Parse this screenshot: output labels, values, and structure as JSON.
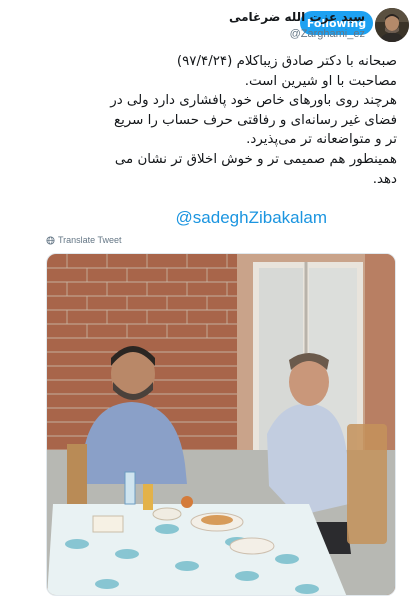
{
  "header": {
    "display_name": "سید عزت الله ضرغامی",
    "handle": "@Zarghami_ez",
    "follow_label": "Following",
    "avatar_icon": "avatar-photo",
    "menu_icon": "chevron-down-icon"
  },
  "tweet": {
    "lines": [
      "صبحانه با دکتر صادق زیباکلام (۹۷/۴/۲۴)",
      "مصاحبت با او شیرین است.",
      "هرچند روی باورهای خاص خود پافشاری دارد ولی در",
      "فضای غیر رسانه‌ای و رفاقتی حرف حساب را سریع",
      "تر  و متواضعانه تر می‌پذیرد.",
      "همینطور هم صمیمی تر و خوش اخلاق تر نشان می",
      "دهد."
    ],
    "mention": "@sadeghZibakalam",
    "translate_label": "Translate Tweet",
    "translate_icon": "globe-icon"
  },
  "colors": {
    "accent": "#1da1f2",
    "link": "#1b95e0",
    "muted": "#657786"
  }
}
